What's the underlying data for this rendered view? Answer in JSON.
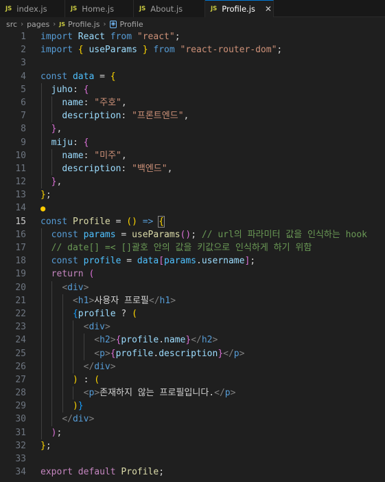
{
  "tabs": [
    {
      "icon": "JS",
      "label": "index.js",
      "active": false
    },
    {
      "icon": "JS",
      "label": "Home.js",
      "active": false
    },
    {
      "icon": "JS",
      "label": "About.js",
      "active": false
    },
    {
      "icon": "JS",
      "label": "Profile.js",
      "active": true
    }
  ],
  "tab_close": "✕",
  "breadcrumb": [
    "src",
    "pages",
    "Profile.js",
    "Profile"
  ],
  "current_line": 15,
  "code_lines": [
    {
      "n": "1",
      "t": [
        [
          "kw",
          "import"
        ],
        [
          "txt",
          " "
        ],
        [
          "var",
          "React"
        ],
        [
          "txt",
          " "
        ],
        [
          "kw",
          "from"
        ],
        [
          "txt",
          " "
        ],
        [
          "str",
          "\"react\""
        ],
        [
          "txt",
          ";"
        ]
      ]
    },
    {
      "n": "2",
      "t": [
        [
          "kw",
          "import"
        ],
        [
          "txt",
          " "
        ],
        [
          "b1",
          "{"
        ],
        [
          "txt",
          " "
        ],
        [
          "var",
          "useParams"
        ],
        [
          "txt",
          " "
        ],
        [
          "b1",
          "}"
        ],
        [
          "txt",
          " "
        ],
        [
          "kw",
          "from"
        ],
        [
          "txt",
          " "
        ],
        [
          "str",
          "\"react-router-dom\""
        ],
        [
          "txt",
          ";"
        ]
      ]
    },
    {
      "n": "3",
      "t": []
    },
    {
      "n": "4",
      "t": [
        [
          "kw",
          "const"
        ],
        [
          "txt",
          " "
        ],
        [
          "cst",
          "data"
        ],
        [
          "txt",
          " = "
        ],
        [
          "b1",
          "{"
        ]
      ]
    },
    {
      "n": "5",
      "t": [
        [
          "txt",
          "  "
        ],
        [
          "var",
          "juho"
        ],
        [
          "txt",
          ": "
        ],
        [
          "b2",
          "{"
        ]
      ]
    },
    {
      "n": "6",
      "t": [
        [
          "txt",
          "    "
        ],
        [
          "var",
          "name"
        ],
        [
          "txt",
          ": "
        ],
        [
          "str",
          "\"주호\""
        ],
        [
          "txt",
          ","
        ]
      ]
    },
    {
      "n": "7",
      "t": [
        [
          "txt",
          "    "
        ],
        [
          "var",
          "description"
        ],
        [
          "txt",
          ": "
        ],
        [
          "str",
          "\"프론트엔드\""
        ],
        [
          "txt",
          ","
        ]
      ]
    },
    {
      "n": "8",
      "t": [
        [
          "txt",
          "  "
        ],
        [
          "b2",
          "}"
        ],
        [
          "txt",
          ","
        ]
      ]
    },
    {
      "n": "9",
      "t": [
        [
          "txt",
          "  "
        ],
        [
          "var",
          "miju"
        ],
        [
          "txt",
          ": "
        ],
        [
          "b2",
          "{"
        ]
      ]
    },
    {
      "n": "10",
      "t": [
        [
          "txt",
          "    "
        ],
        [
          "var",
          "name"
        ],
        [
          "txt",
          ": "
        ],
        [
          "str",
          "\"미주\""
        ],
        [
          "txt",
          ","
        ]
      ]
    },
    {
      "n": "11",
      "t": [
        [
          "txt",
          "    "
        ],
        [
          "var",
          "description"
        ],
        [
          "txt",
          ": "
        ],
        [
          "str",
          "\"백엔드\""
        ],
        [
          "txt",
          ","
        ]
      ]
    },
    {
      "n": "12",
      "t": [
        [
          "txt",
          "  "
        ],
        [
          "b2",
          "}"
        ],
        [
          "txt",
          ","
        ]
      ]
    },
    {
      "n": "13",
      "t": [
        [
          "b1",
          "}"
        ],
        [
          "txt",
          ";"
        ]
      ]
    },
    {
      "n": "14",
      "t": [],
      "bulb": true
    },
    {
      "n": "15",
      "t": [
        [
          "kw",
          "const"
        ],
        [
          "txt",
          " "
        ],
        [
          "fn",
          "Profile"
        ],
        [
          "txt",
          " = "
        ],
        [
          "b1",
          "()"
        ],
        [
          "txt",
          " "
        ],
        [
          "kw",
          "=>"
        ],
        [
          "txt",
          " "
        ],
        [
          "b1",
          "{"
        ]
      ]
    },
    {
      "n": "16",
      "t": [
        [
          "txt",
          "  "
        ],
        [
          "kw",
          "const"
        ],
        [
          "txt",
          " "
        ],
        [
          "cst",
          "params"
        ],
        [
          "txt",
          " = "
        ],
        [
          "fn",
          "useParams"
        ],
        [
          "b2",
          "()"
        ],
        [
          "txt",
          "; "
        ],
        [
          "cm",
          "// url의 파라미터 값을 인식하는 hook"
        ]
      ]
    },
    {
      "n": "17",
      "t": [
        [
          "txt",
          "  "
        ],
        [
          "cm",
          "// date[] =< []괄호 안의 값을 키값으로 인식하게 하기 위함"
        ]
      ]
    },
    {
      "n": "18",
      "t": [
        [
          "txt",
          "  "
        ],
        [
          "kw",
          "const"
        ],
        [
          "txt",
          " "
        ],
        [
          "cst",
          "profile"
        ],
        [
          "txt",
          " = "
        ],
        [
          "cst",
          "data"
        ],
        [
          "b2",
          "["
        ],
        [
          "cst",
          "params"
        ],
        [
          "txt",
          "."
        ],
        [
          "var",
          "username"
        ],
        [
          "b2",
          "]"
        ],
        [
          "txt",
          ";"
        ]
      ]
    },
    {
      "n": "19",
      "t": [
        [
          "txt",
          "  "
        ],
        [
          "ctl",
          "return"
        ],
        [
          "txt",
          " "
        ],
        [
          "b2",
          "("
        ]
      ]
    },
    {
      "n": "20",
      "t": [
        [
          "txt",
          "    "
        ],
        [
          "brk",
          "<"
        ],
        [
          "tag",
          "div"
        ],
        [
          "brk",
          ">"
        ]
      ]
    },
    {
      "n": "21",
      "t": [
        [
          "txt",
          "      "
        ],
        [
          "brk",
          "<"
        ],
        [
          "tag",
          "h1"
        ],
        [
          "brk",
          ">"
        ],
        [
          "txt",
          "사용자 프로필"
        ],
        [
          "brk",
          "</"
        ],
        [
          "tag",
          "h1"
        ],
        [
          "brk",
          ">"
        ]
      ]
    },
    {
      "n": "22",
      "t": [
        [
          "txt",
          "      "
        ],
        [
          "b3",
          "{"
        ],
        [
          "var",
          "profile"
        ],
        [
          "txt",
          " ? "
        ],
        [
          "b1",
          "("
        ]
      ]
    },
    {
      "n": "23",
      "t": [
        [
          "txt",
          "        "
        ],
        [
          "brk",
          "<"
        ],
        [
          "tag",
          "div"
        ],
        [
          "brk",
          ">"
        ]
      ]
    },
    {
      "n": "24",
      "t": [
        [
          "txt",
          "          "
        ],
        [
          "brk",
          "<"
        ],
        [
          "tag",
          "h2"
        ],
        [
          "brk",
          ">"
        ],
        [
          "b2",
          "{"
        ],
        [
          "var",
          "profile"
        ],
        [
          "txt",
          "."
        ],
        [
          "var",
          "name"
        ],
        [
          "b2",
          "}"
        ],
        [
          "brk",
          "</"
        ],
        [
          "tag",
          "h2"
        ],
        [
          "brk",
          ">"
        ]
      ]
    },
    {
      "n": "25",
      "t": [
        [
          "txt",
          "          "
        ],
        [
          "brk",
          "<"
        ],
        [
          "tag",
          "p"
        ],
        [
          "brk",
          ">"
        ],
        [
          "b2",
          "{"
        ],
        [
          "var",
          "profile"
        ],
        [
          "txt",
          "."
        ],
        [
          "var",
          "description"
        ],
        [
          "b2",
          "}"
        ],
        [
          "brk",
          "</"
        ],
        [
          "tag",
          "p"
        ],
        [
          "brk",
          ">"
        ]
      ]
    },
    {
      "n": "26",
      "t": [
        [
          "txt",
          "        "
        ],
        [
          "brk",
          "</"
        ],
        [
          "tag",
          "div"
        ],
        [
          "brk",
          ">"
        ]
      ]
    },
    {
      "n": "27",
      "t": [
        [
          "txt",
          "      "
        ],
        [
          "b1",
          ")"
        ],
        [
          "txt",
          " : "
        ],
        [
          "b1",
          "("
        ]
      ]
    },
    {
      "n": "28",
      "t": [
        [
          "txt",
          "        "
        ],
        [
          "brk",
          "<"
        ],
        [
          "tag",
          "p"
        ],
        [
          "brk",
          ">"
        ],
        [
          "txt",
          "존재하지 않는 프로필입니다."
        ],
        [
          "brk",
          "</"
        ],
        [
          "tag",
          "p"
        ],
        [
          "brk",
          ">"
        ]
      ]
    },
    {
      "n": "29",
      "t": [
        [
          "txt",
          "      "
        ],
        [
          "b1",
          ")"
        ],
        [
          "b3",
          "}"
        ]
      ]
    },
    {
      "n": "30",
      "t": [
        [
          "txt",
          "    "
        ],
        [
          "brk",
          "</"
        ],
        [
          "tag",
          "div"
        ],
        [
          "brk",
          ">"
        ]
      ]
    },
    {
      "n": "31",
      "t": [
        [
          "txt",
          "  "
        ],
        [
          "b2",
          ")"
        ],
        [
          "txt",
          ";"
        ]
      ]
    },
    {
      "n": "32",
      "t": [
        [
          "b1",
          "}"
        ],
        [
          "txt",
          ";"
        ]
      ]
    },
    {
      "n": "33",
      "t": []
    },
    {
      "n": "34",
      "t": [
        [
          "ctl",
          "export"
        ],
        [
          "txt",
          " "
        ],
        [
          "ctl",
          "default"
        ],
        [
          "txt",
          " "
        ],
        [
          "fn",
          "Profile"
        ],
        [
          "txt",
          ";"
        ]
      ]
    }
  ]
}
